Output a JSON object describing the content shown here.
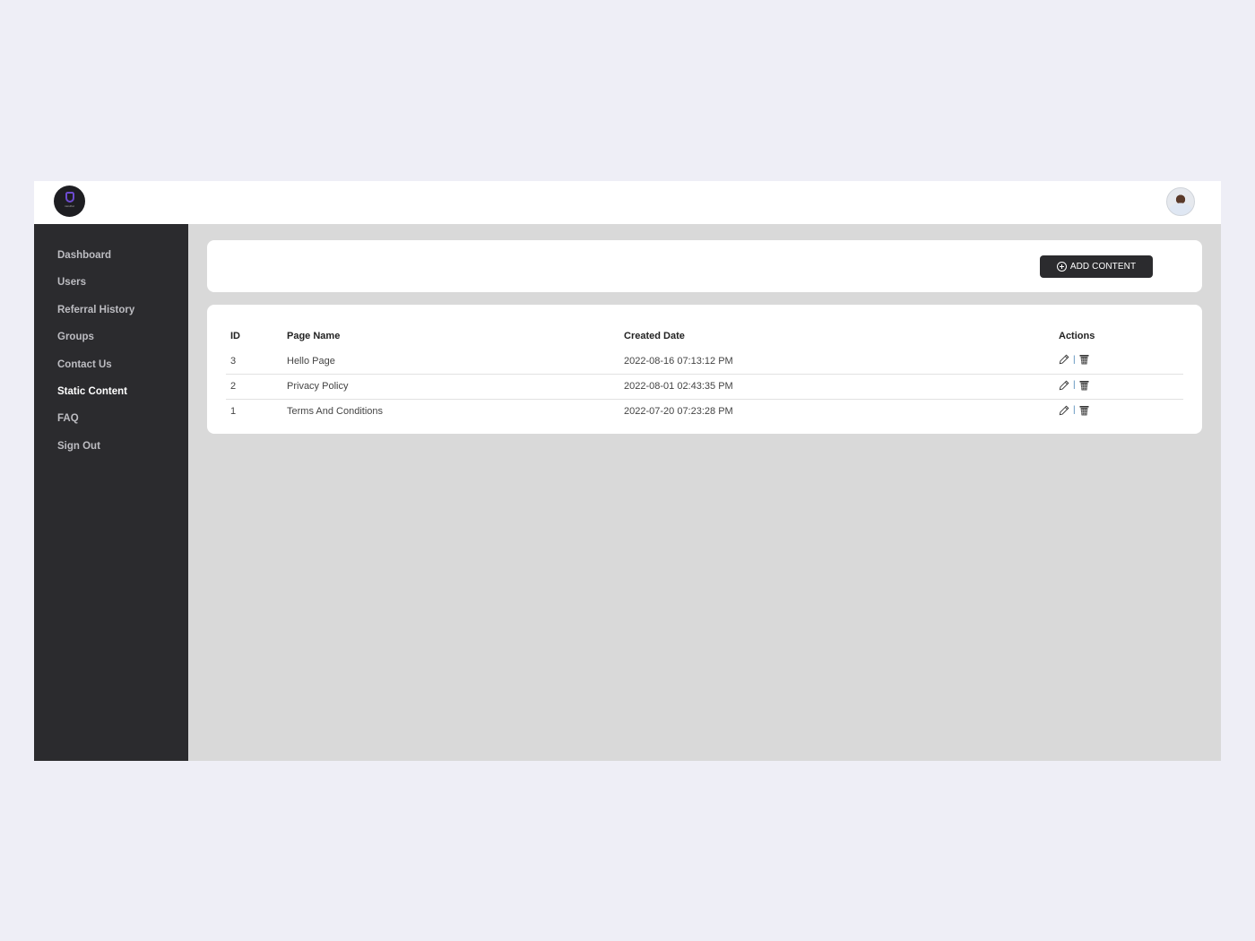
{
  "topbar": {
    "logo_text": "mindful",
    "avatar_alt": "user-avatar"
  },
  "sidebar": {
    "items": [
      {
        "label": "Dashboard",
        "active": false
      },
      {
        "label": "Users",
        "active": false
      },
      {
        "label": "Referral History",
        "active": false
      },
      {
        "label": "Groups",
        "active": false
      },
      {
        "label": "Contact Us",
        "active": false
      },
      {
        "label": "Static Content",
        "active": true
      },
      {
        "label": "FAQ",
        "active": false
      },
      {
        "label": "Sign Out",
        "active": false
      }
    ]
  },
  "toolbar": {
    "add_label": "ADD CONTENT"
  },
  "table": {
    "headers": {
      "id": "ID",
      "name": "Page Name",
      "date": "Created Date",
      "actions": "Actions"
    },
    "rows": [
      {
        "id": "3",
        "name": "Hello Page",
        "date": "2022-08-16 07:13:12 PM"
      },
      {
        "id": "2",
        "name": "Privacy Policy",
        "date": "2022-08-01 02:43:35 PM"
      },
      {
        "id": "1",
        "name": "Terms And Conditions",
        "date": "2022-07-20 07:23:28 PM"
      }
    ],
    "action_separator": "|"
  },
  "colors": {
    "sidebar_bg": "#2b2b2e",
    "content_bg": "#d9d9d9",
    "page_bg": "#eeeef6",
    "accent": "#6d4bd1"
  }
}
